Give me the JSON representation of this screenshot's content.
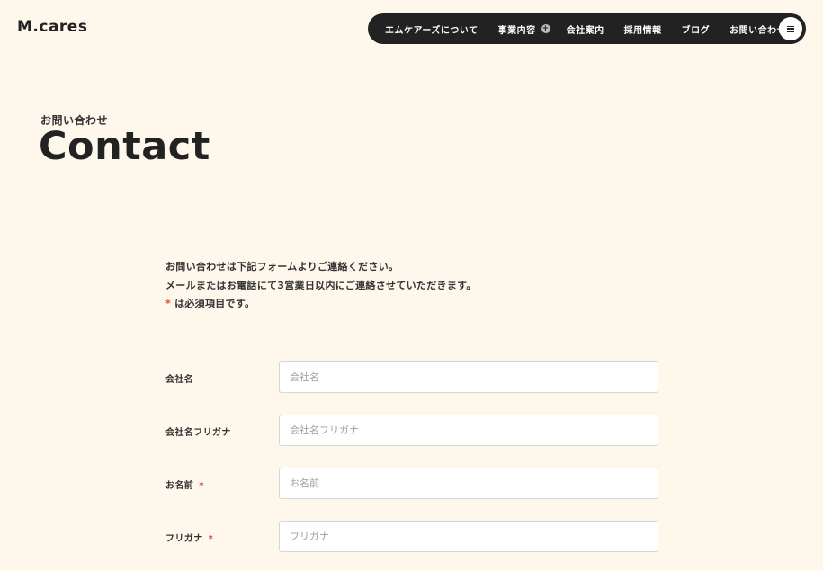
{
  "header": {
    "logo": "M.cares",
    "nav": {
      "about": "エムケアーズについて",
      "business": "事業内容",
      "company": "会社案内",
      "recruit": "採用情報",
      "blog": "ブログ",
      "contact": "お問い合わせ"
    }
  },
  "page": {
    "subtitle": "お問い合わせ",
    "title": "Contact"
  },
  "intro": {
    "line1": "お問い合わせは下記フォームよりご連絡ください。",
    "line2": "メールまたはお電話にて3営業日以内にご連絡させていただきます。",
    "required_mark": "*",
    "line3": "は必須項目です。"
  },
  "form": {
    "fields": [
      {
        "label": "会社名",
        "placeholder": "会社名",
        "required": false,
        "value": ""
      },
      {
        "label": "会社名フリガナ",
        "placeholder": "会社名フリガナ",
        "required": false,
        "value": ""
      },
      {
        "label": "お名前",
        "placeholder": "お名前",
        "required": true,
        "value": ""
      },
      {
        "label": "フリガナ",
        "placeholder": "フリガナ",
        "required": true,
        "value": ""
      }
    ],
    "required_mark": "*"
  },
  "colors": {
    "background": "#fdf7ec",
    "nav_bg": "#222222",
    "required": "#e0463c",
    "text": "#2b2b2b"
  }
}
